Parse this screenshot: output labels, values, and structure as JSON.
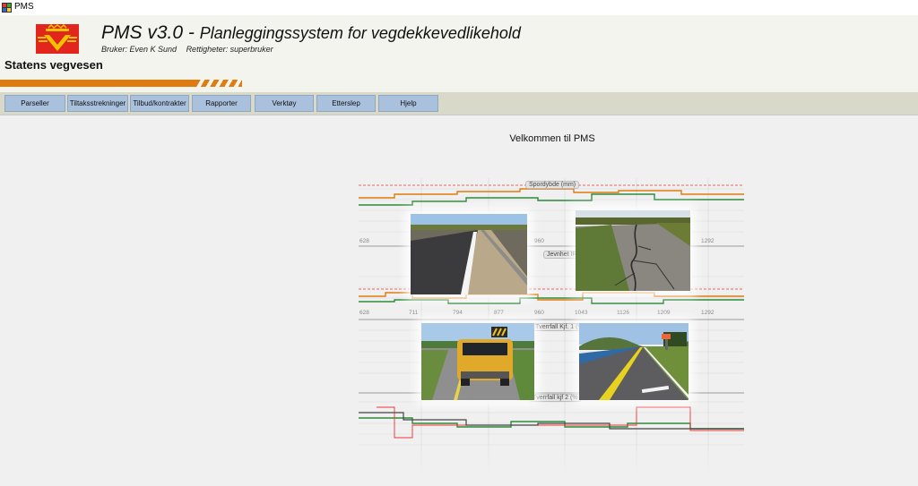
{
  "window": {
    "title": "PMS"
  },
  "header": {
    "app_name": "PMS v3.0",
    "app_subtitle": "Planleggingssystem for vegdekkevedlikehold",
    "user": "Bruker: Even K Sund",
    "rights": "Rettigheter: superbruker",
    "organization": "Statens vegvesen"
  },
  "menu": [
    {
      "label": "Parseller"
    },
    {
      "label": "Tiltaksstrekninger"
    },
    {
      "label": "Tilbud/kontrakter"
    },
    {
      "label": "Rapporter"
    },
    {
      "label": "Verktøy"
    },
    {
      "label": "Etterslep"
    },
    {
      "label": "Hjelp"
    }
  ],
  "main": {
    "welcome": "Velkommen til PMS",
    "graph_labels": [
      "Spordybde (mm)",
      "Jevnhet IRI (mm",
      "Tverrfall Kjf. 1 (%",
      "Tverrfall kjf 2 (%"
    ],
    "axis_row1": [
      "628",
      "960",
      "1292"
    ],
    "axis_row2": [
      "628",
      "711",
      "794",
      "877",
      "960",
      "1043",
      "1126",
      "1209",
      "1292"
    ]
  },
  "colors": {
    "menu_button": "#a9c1dc",
    "menubar": "#d9d9c9",
    "accent_stripe": "#e07b0e",
    "logo_red": "#e2261e"
  }
}
